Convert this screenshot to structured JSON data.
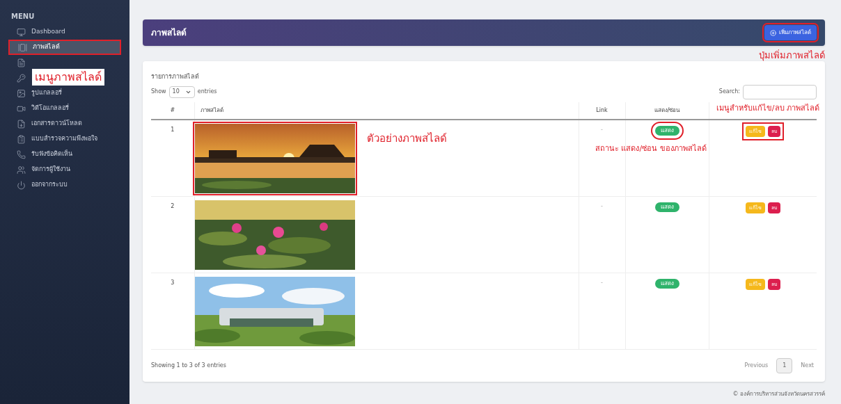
{
  "sidebar": {
    "heading": "MENU",
    "items": [
      {
        "label": "Dashboard",
        "selected": false
      },
      {
        "label": "ภาพสไลด์",
        "selected": true
      },
      {
        "selected": false
      },
      {
        "selected": false
      },
      {
        "label": "รูปแกลลอรี่",
        "selected": false
      },
      {
        "label": "วิดีโอแกลลอรี่",
        "selected": false
      },
      {
        "label": "เอกสารดาวน์โหลด",
        "selected": false
      },
      {
        "label": "แบบสำรวจความพึงพอใจ",
        "selected": false
      },
      {
        "label": "รับฟังข้อคิดเห็น",
        "selected": false
      },
      {
        "label": "จัดการผู้ใช้งาน",
        "selected": false
      },
      {
        "label": "ออกจากระบบ",
        "selected": false
      }
    ]
  },
  "header": {
    "title": "ภาพสไลด์",
    "add_button": "เพิ่มภาพสไลด์"
  },
  "card": {
    "title": "รายการภาพสไลด์",
    "length": {
      "before": "Show",
      "value": "10",
      "after": "entries"
    },
    "search_label": "Search:",
    "columns": [
      "#",
      "ภาพสไลด์",
      "Link",
      "แสดง/ซ่อน"
    ],
    "rows": [
      {
        "no": "1",
        "link": "-",
        "status": "แสดง",
        "visible": true,
        "edit": "แก้ไข",
        "delete": "ลบ"
      },
      {
        "no": "2",
        "link": "-",
        "status": "แสดง",
        "visible": true,
        "edit": "แก้ไข",
        "delete": "ลบ"
      },
      {
        "no": "3",
        "link": "-",
        "status": "แสดง",
        "visible": true,
        "edit": "แก้ไข",
        "delete": "ลบ"
      }
    ],
    "info": "Showing 1 to 3 of 3 entries",
    "pagination": [
      {
        "label": "Previous",
        "selected": false
      },
      {
        "label": "1",
        "selected": true
      },
      {
        "label": "Next",
        "selected": false
      }
    ]
  },
  "footer": "© องค์การบริหารส่วนจังหวัดนครสวรรค์",
  "annotations": {
    "menu": "เมนูภาพสไลด์",
    "add": "ปุ่มเพิ่มภาพสไลด์",
    "actions": "เมนูสำหรับแก้ไข/ลบ ภาพสไลด์",
    "preview": "ตัวอย่างภาพสไลด์",
    "status": "สถานะ แสดง/ซ่อน ของภาพสไลด์"
  }
}
